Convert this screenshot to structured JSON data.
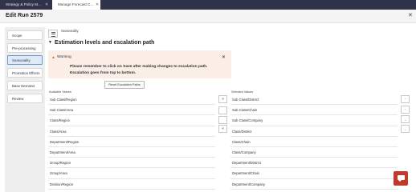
{
  "tabs": [
    {
      "label": "Strategy & Policy M...",
      "close": "✕"
    },
    {
      "label": "Manage Forecast C...",
      "close": "✕"
    }
  ],
  "header": {
    "title": "Edit Run 2579",
    "close": "✕"
  },
  "sidebar": {
    "items": [
      {
        "label": "Scope"
      },
      {
        "label": "Pre-processing"
      },
      {
        "label": "Seasonality"
      },
      {
        "label": "Promotion Effects"
      },
      {
        "label": "Base Demand"
      },
      {
        "label": "Review"
      }
    ]
  },
  "main": {
    "breadcrumb": "Seasonality",
    "section_title": "Estimation levels and escalation path",
    "warning": {
      "title": "Warning",
      "message": "Please remember to click on Save after making changes to escalation path. Escalation goes from top to bottom.",
      "close": "✕"
    },
    "reset_label": "Reset Escalation Paths",
    "available": {
      "label": "Available Values",
      "items": [
        "Sub Class/Region",
        "Sub Class/Area",
        "Class/Region",
        "Class/Area",
        "Department/Region",
        "Department/Area",
        "Group/Region",
        "Group/Area",
        "Division/Region"
      ]
    },
    "selected": {
      "label": "Selected Values",
      "items": [
        "Sub Class/District",
        "Sub Class/Chain",
        "Sub Class/Company",
        "Class/District",
        "Class/Chain",
        "Class/Company",
        "Department/District",
        "Department/Chain",
        "Department/Company"
      ]
    },
    "transfer_buttons": [
      "»",
      "",
      "",
      "«"
    ],
    "order_buttons": [
      "⌃",
      "⌃",
      "⌄",
      "⌄"
    ]
  },
  "colors": {
    "topbar": "#31334a",
    "active_item": "#dfeaf6",
    "warning_bg": "#fbeee6",
    "chat_button": "#c0392b"
  }
}
